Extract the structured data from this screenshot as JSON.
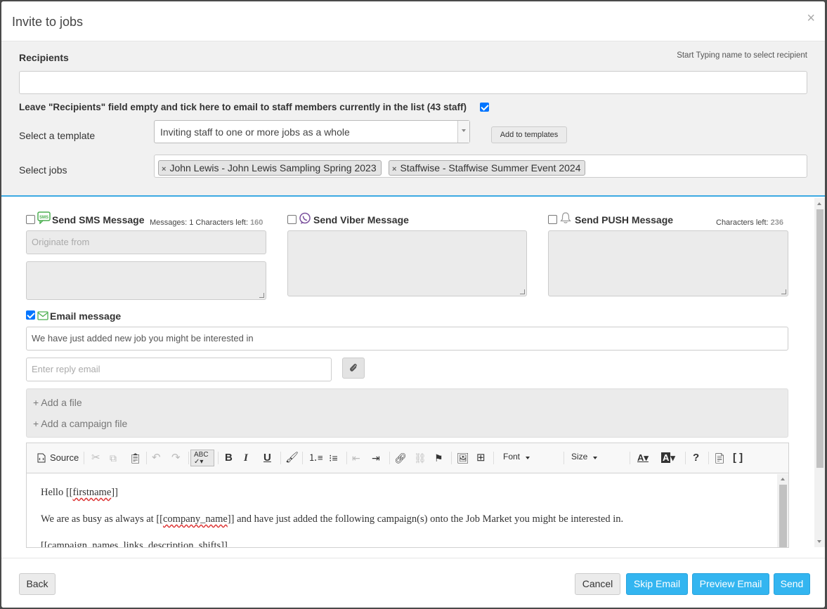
{
  "dialog": {
    "title": "Invite to jobs",
    "close": "×"
  },
  "recipients": {
    "label": "Recipients",
    "hint": "Start Typing name to select recipient",
    "value": "",
    "empty_tick_label": "Leave \"Recipients\" field empty and tick here to email to staff members currently in the list (43 staff)",
    "empty_tick_checked": true
  },
  "template": {
    "label": "Select a template",
    "selected": "Inviting staff to one or more jobs as a whole",
    "add_button": "Add to templates"
  },
  "jobs": {
    "label": "Select jobs",
    "tags": [
      {
        "remove": "×",
        "text": "John Lewis - John Lewis Sampling Spring 2023"
      },
      {
        "remove": "×",
        "text": "Staffwise - Staffwise Summer Event 2024"
      }
    ]
  },
  "sms": {
    "icon": "sms-icon",
    "icon_text": "SMS",
    "title": "Send SMS Message",
    "counter_prefix": "Messages: 1 Characters left: ",
    "counter_value": "160",
    "originate_placeholder": "Originate from",
    "checked": false
  },
  "viber": {
    "icon": "viber-icon",
    "title": "Send Viber Message",
    "checked": false
  },
  "push": {
    "icon": "bell-icon",
    "title": "Send PUSH Message",
    "counter_prefix": "Characters left: ",
    "counter_value": "236",
    "checked": false
  },
  "email": {
    "icon": "envelope-icon",
    "title": "Email message",
    "checked": true,
    "subject": "We have just added new job you might be interested in",
    "reply_placeholder": "Enter reply email",
    "attach_icon": "paperclip-icon",
    "add_file": "+ Add a file",
    "add_campaign_file": "+ Add a campaign file"
  },
  "editor": {
    "toolbar": {
      "source": "Source",
      "font": "Font",
      "size": "Size"
    },
    "lines": [
      {
        "before": "Hello [[",
        "token": "firstname",
        "after": "]]"
      },
      {
        "before": "We are as busy as always at [[",
        "token": "company_name",
        "after": "]] and have just added the following campaign(s) onto the Job Market you might be interested in."
      },
      {
        "before": "[[campaign_names_links_description_shifts]]",
        "token": "",
        "after": ""
      }
    ]
  },
  "footer": {
    "back": "Back",
    "cancel": "Cancel",
    "skip": "Skip Email",
    "preview": "Preview Email",
    "send": "Send"
  },
  "colors": {
    "accent": "#33b5f0",
    "panel": "#f1f1f1",
    "divider": "#3ca9e2",
    "checkbox": "#0075ff",
    "sms_green": "#4caf50",
    "viber_purple": "#7b519d"
  }
}
